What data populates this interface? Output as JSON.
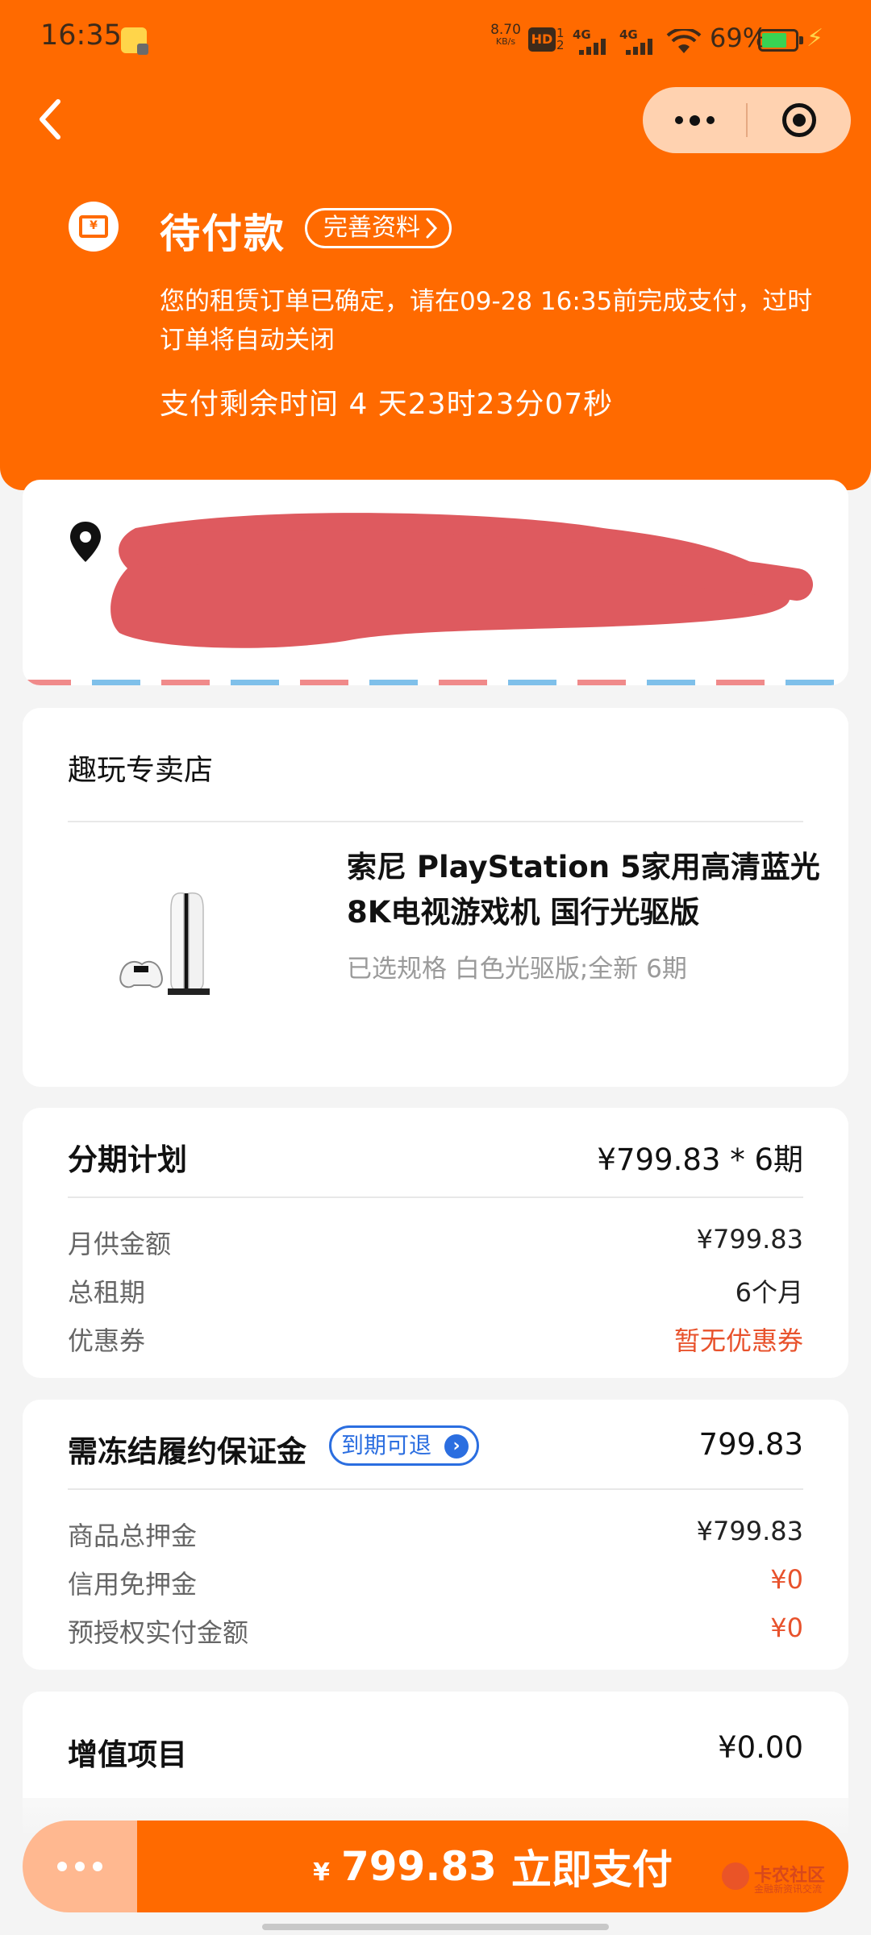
{
  "status_bar": {
    "time": "16:35",
    "net_speed_value": "8.70",
    "net_speed_unit": "KB/s",
    "hd_label": "HD",
    "hd_sub": "1 2",
    "sim1": "4G",
    "sim2": "4G",
    "battery_percent": "69%",
    "battery_color": "#39d353"
  },
  "nav": {
    "back_icon": "chevron-left-icon",
    "more_icon": "more-dots-icon",
    "close_icon": "target-icon"
  },
  "order_status": {
    "icon": "wallet-icon",
    "icon_glyph": "¥",
    "title": "待付款",
    "complete_button": "完善资料",
    "notice": "您的租赁订单已确定，请在09-28 16:35前完成支付，过时订单将自动关闭",
    "countdown": "支付剩余时间 4 天23时23分07秒"
  },
  "address": {
    "icon": "location-pin-icon"
  },
  "shop": {
    "name": "趣玩专卖店",
    "product": {
      "name": "索尼 PlayStation 5家用高清蓝光8K电视游戏机 国行光驱版",
      "spec": "已选规格 白色光驱版;全新 6期",
      "image": "ps5-console-image"
    }
  },
  "plan": {
    "title": "分期计划",
    "summary": "¥799.83 * 6期",
    "rows": [
      {
        "label": "月供金额",
        "value": "¥799.83"
      },
      {
        "label": "总租期",
        "value": "6个月"
      },
      {
        "label": "优惠券",
        "value": "暂无优惠券"
      }
    ]
  },
  "deposit": {
    "title": "需冻结履约保证金",
    "tag": "到期可退",
    "amount": "799.83",
    "rows": [
      {
        "label": "商品总押金",
        "value": "¥799.83"
      },
      {
        "label": "信用免押金",
        "value": "¥0"
      },
      {
        "label": "预授权实付金额",
        "value": "¥0"
      }
    ]
  },
  "value_added": {
    "title": "增值项目",
    "amount": "¥0.00"
  },
  "footer": {
    "currency": "¥",
    "amount": "799.83",
    "pay_label": "立即支付",
    "watermark_title": "卡农社区",
    "watermark_sub": "金融新资讯交流",
    "accent_color": "#ff6a00"
  }
}
